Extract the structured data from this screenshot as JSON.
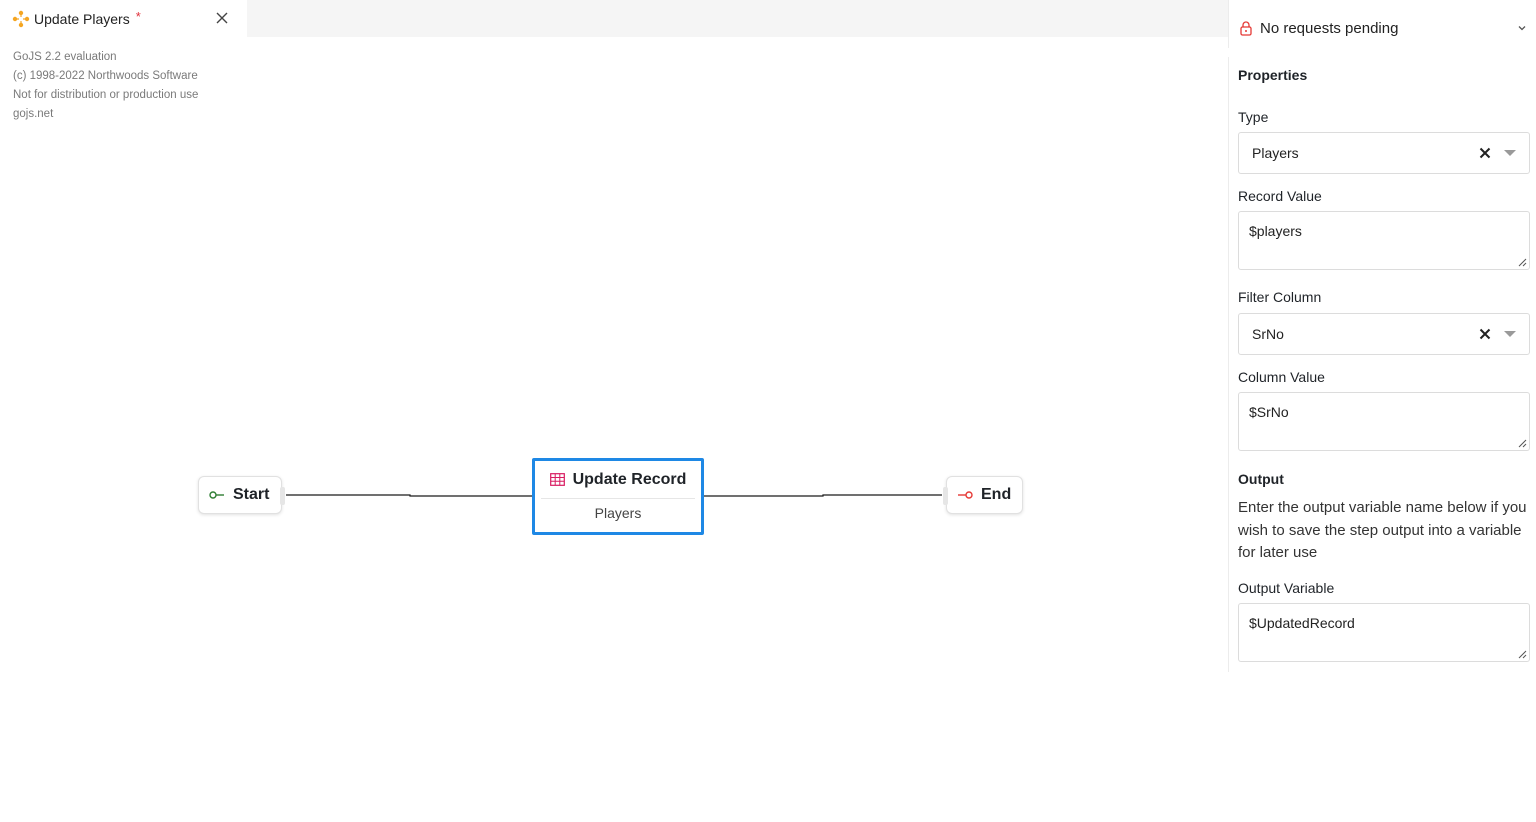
{
  "tab": {
    "title": "Update Players",
    "unsaved_marker": "*",
    "icon": "workflow-icon",
    "close_icon": "close-icon"
  },
  "watermark": {
    "lines": [
      "GoJS 2.2 evaluation",
      "(c) 1998-2022 Northwoods Software",
      "Not for distribution or production use",
      "gojs.net"
    ]
  },
  "diagram": {
    "start_label": "Start",
    "end_label": "End",
    "task": {
      "title": "Update Record",
      "subtitle": "Players",
      "icon": "table-icon"
    },
    "colors": {
      "selection": "#1e88e5",
      "start_icon": "#2e7d32",
      "end_icon": "#e53935",
      "task_icon": "#d81b60"
    }
  },
  "panel": {
    "pending_text": "No requests pending",
    "properties_title": "Properties",
    "type": {
      "label": "Type",
      "value": "Players"
    },
    "record_value": {
      "label": "Record Value",
      "value": "$players"
    },
    "filter_column": {
      "label": "Filter Column",
      "value": "SrNo"
    },
    "column_value": {
      "label": "Column Value",
      "value": "$SrNo"
    },
    "output_title": "Output",
    "output_help": "Enter the output variable name below if you wish to save the step output into a variable for later use",
    "output_variable": {
      "label": "Output Variable",
      "value": "$UpdatedRecord"
    }
  }
}
